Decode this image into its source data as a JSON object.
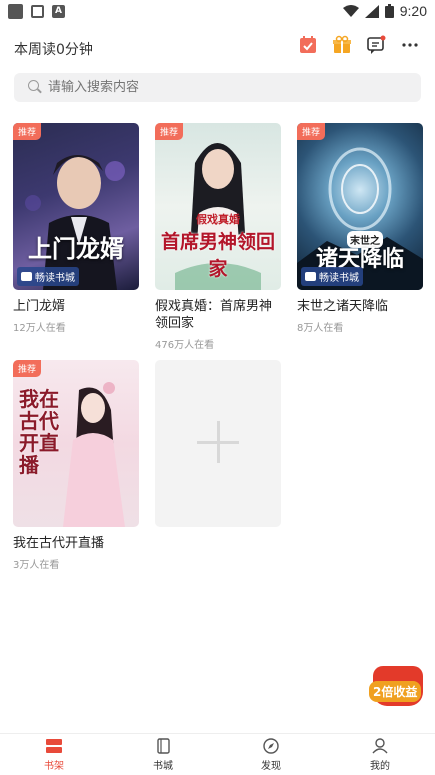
{
  "status_bar": {
    "time": "9:20"
  },
  "header": {
    "read_time": "本周读0分钟"
  },
  "search": {
    "placeholder": "请输入搜索内容"
  },
  "books": [
    {
      "badge": "推荐",
      "cover_text": "上门龙婿",
      "publisher": "畅读书城",
      "title": "上门龙婿",
      "reads": "12万人在看"
    },
    {
      "badge": "推荐",
      "cover_text": "首席男神领回家",
      "cover_subtext": "假戏真婚",
      "title": "假戏真婚：首席男神领回家",
      "reads": "476万人在看"
    },
    {
      "badge": "推荐",
      "cover_text": "诸天降临",
      "cover_subtext": "末世之",
      "publisher": "畅读书城",
      "title": "末世之诸天降临",
      "reads": "8万人在看"
    },
    {
      "badge": "推荐",
      "cover_text": "我在古代开直播",
      "title": "我在古代开直播",
      "reads": "3万人在看"
    }
  ],
  "promo": {
    "text": "2倍收益"
  },
  "nav": [
    {
      "label": "书架",
      "icon": "bookshelf-icon",
      "active": true
    },
    {
      "label": "书城",
      "icon": "bookstore-icon",
      "active": false
    },
    {
      "label": "发现",
      "icon": "discover-icon",
      "active": false
    },
    {
      "label": "我的",
      "icon": "profile-icon",
      "active": false
    }
  ],
  "colors": {
    "accent": "#e84a3a",
    "badge": "#f26d5a",
    "promo": "#e33a2a"
  }
}
